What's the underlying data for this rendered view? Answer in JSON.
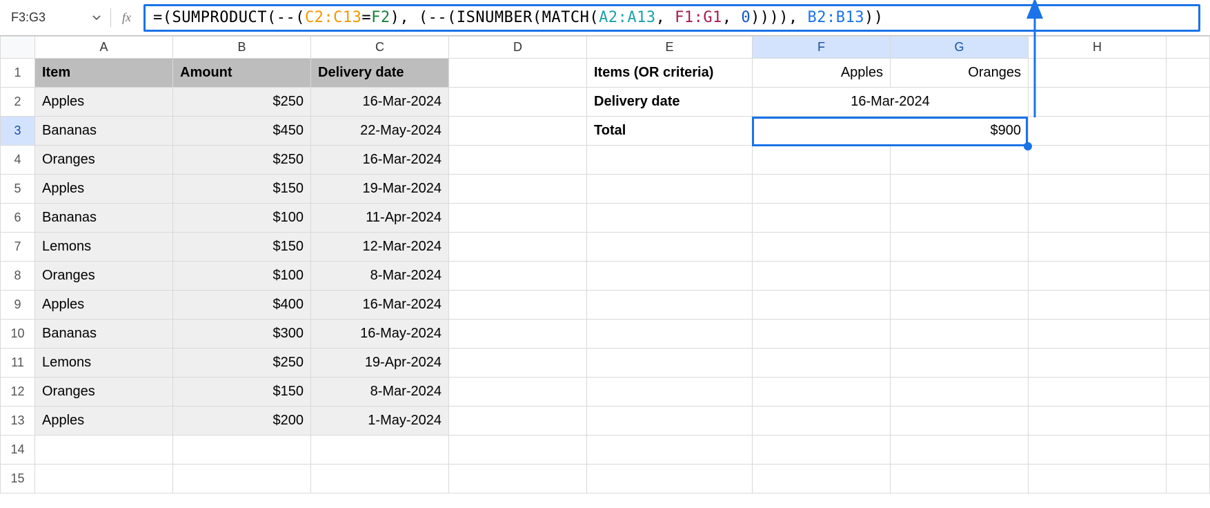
{
  "nameBox": "F3:G3",
  "fx": "fx",
  "formula": {
    "prefix": "=(",
    "fn1": "SUMPRODUCT",
    "p1": "(--(",
    "r1": "C2:C13",
    "eq": "=",
    "r2": "F2",
    "p2": "), (--(",
    "fn2": "ISNUMBER",
    "p3": "(",
    "fn3": "MATCH",
    "p4": "(",
    "r3": "A2:A13",
    "c1": ", ",
    "r4": "F1:G1",
    "c2": ", ",
    "zero": "0",
    "p5": ")))), ",
    "r5": "B2:B13",
    "p6": "))"
  },
  "colHeaders": {
    "A": "A",
    "B": "B",
    "C": "C",
    "D": "D",
    "E": "E",
    "F": "F",
    "G": "G",
    "H": "H"
  },
  "rowHeaders": [
    "1",
    "2",
    "3",
    "4",
    "5",
    "6",
    "7",
    "8",
    "9",
    "10",
    "11",
    "12",
    "13",
    "14",
    "15"
  ],
  "headers": {
    "item": "Item",
    "amount": "Amount",
    "delivery": "Delivery date"
  },
  "rows": [
    {
      "item": "Apples",
      "amount": "$250",
      "date": "16-Mar-2024"
    },
    {
      "item": "Bananas",
      "amount": "$450",
      "date": "22-May-2024"
    },
    {
      "item": "Oranges",
      "amount": "$250",
      "date": "16-Mar-2024"
    },
    {
      "item": "Apples",
      "amount": "$150",
      "date": "19-Mar-2024"
    },
    {
      "item": "Bananas",
      "amount": "$100",
      "date": "11-Apr-2024"
    },
    {
      "item": "Lemons",
      "amount": "$150",
      "date": "12-Mar-2024"
    },
    {
      "item": "Oranges",
      "amount": "$100",
      "date": "8-Mar-2024"
    },
    {
      "item": "Apples",
      "amount": "$400",
      "date": "16-Mar-2024"
    },
    {
      "item": "Bananas",
      "amount": "$300",
      "date": "16-May-2024"
    },
    {
      "item": "Lemons",
      "amount": "$250",
      "date": "19-Apr-2024"
    },
    {
      "item": "Oranges",
      "amount": "$150",
      "date": "8-Mar-2024"
    },
    {
      "item": "Apples",
      "amount": "$200",
      "date": "1-May-2024"
    }
  ],
  "criteria": {
    "itemsLabel": "Items (OR criteria)",
    "item1": "Apples",
    "item2": "Oranges",
    "dateLabel": "Delivery date",
    "dateValue": "16-Mar-2024",
    "totalLabel": "Total",
    "totalValue": "$900"
  }
}
